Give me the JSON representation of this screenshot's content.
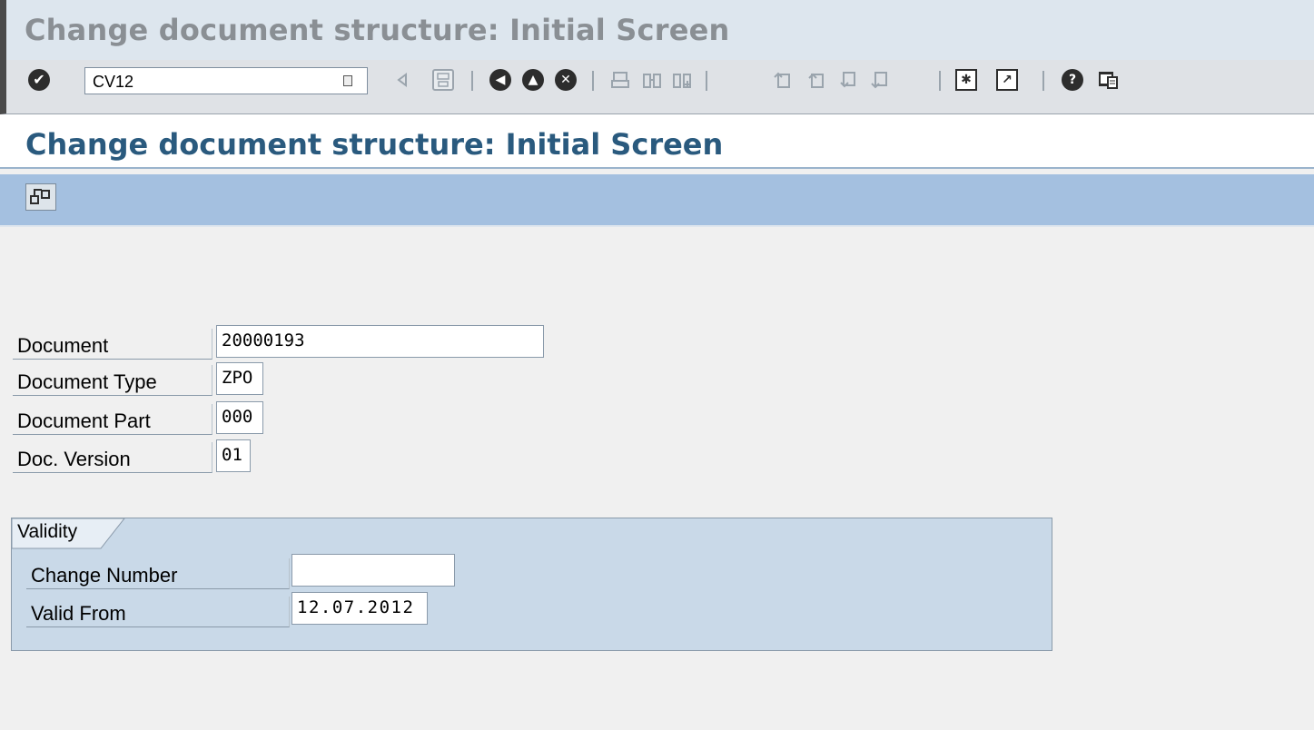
{
  "window": {
    "title": "Change document structure: Initial Screen"
  },
  "toolbar": {
    "command_value": "CV12",
    "icons": [
      "enter-icon",
      "dropdown-icon",
      "back-arrow-icon",
      "save-icon",
      "back-icon",
      "exit-icon",
      "cancel-icon",
      "print-icon",
      "find-icon",
      "find-next-icon",
      "first-page-icon",
      "previous-page-icon",
      "next-page-icon",
      "last-page-icon",
      "create-session-icon",
      "shortcut-icon",
      "help-icon",
      "layout-menu-icon"
    ]
  },
  "page": {
    "title": "Change document structure: Initial Screen"
  },
  "app_toolbar": {
    "icons": [
      "document-structure-icon"
    ]
  },
  "form": {
    "document_label": "Document",
    "document_value": "20000193",
    "doc_type_label": "Document Type",
    "doc_type_value": "ZPO",
    "doc_part_label": "Document Part",
    "doc_part_value": "000",
    "doc_version_label": "Doc. Version",
    "doc_version_value": "01"
  },
  "validity": {
    "tab_label": "Validity",
    "change_number_label": "Change Number",
    "change_number_value": "",
    "valid_from_label": "Valid From",
    "valid_from_value": "12.07.2012"
  },
  "colors": {
    "title_text": "#8a8f94",
    "page_title_text": "#2a5a7e",
    "app_toolbar_bg": "#a4c0e0",
    "group_bg": "#c9d9e8"
  }
}
